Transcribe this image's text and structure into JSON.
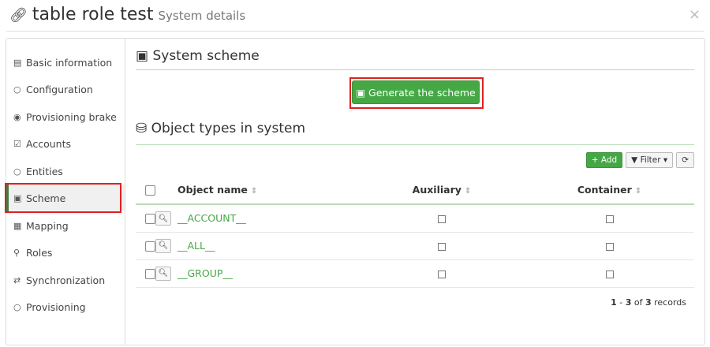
{
  "header": {
    "link_icon": "link-icon",
    "title": "table role test",
    "subtitle": "System details",
    "close_glyph": "×"
  },
  "sidebar": {
    "items": [
      {
        "label": "Basic information",
        "icon": "▤",
        "icon_name": "list-icon",
        "active": false
      },
      {
        "label": "Configuration",
        "icon": "○",
        "icon_name": "circle-icon",
        "active": false
      },
      {
        "label": "Provisioning brake",
        "icon": "◉",
        "icon_name": "dot-circle-icon",
        "active": false
      },
      {
        "label": "Accounts",
        "icon": "☑",
        "icon_name": "edit-icon",
        "active": false
      },
      {
        "label": "Entities",
        "icon": "○",
        "icon_name": "circle-icon",
        "active": false
      },
      {
        "label": "Scheme",
        "icon": "▣",
        "icon_name": "scheme-icon",
        "active": true
      },
      {
        "label": "Mapping",
        "icon": "▦",
        "icon_name": "mapping-icon",
        "active": false
      },
      {
        "label": "Roles",
        "icon": "⚲",
        "icon_name": "key-icon",
        "active": false
      },
      {
        "label": "Synchronization",
        "icon": "⇄",
        "icon_name": "exchange-icon",
        "active": false
      },
      {
        "label": "Provisioning",
        "icon": "○",
        "icon_name": "circle-icon",
        "active": false
      }
    ]
  },
  "scheme": {
    "icon": "▣",
    "title": "System scheme",
    "generate_label": "Generate the scheme"
  },
  "object_types": {
    "icon": "⛁",
    "title": "Object types in system",
    "add_label": "+ Add",
    "filter_label": "▼ Filter ▾",
    "refresh_glyph": "⟳",
    "columns": {
      "name": "Object name",
      "auxiliary": "Auxiliary",
      "container": "Container"
    },
    "sort_glyph": "⇕",
    "rows": [
      {
        "name": "__ACCOUNT__",
        "auxiliary": false,
        "container": false
      },
      {
        "name": "__ALL__",
        "auxiliary": false,
        "container": false
      },
      {
        "name": "__GROUP__",
        "auxiliary": false,
        "container": false
      }
    ],
    "records": {
      "from": "1",
      "sep": " - ",
      "to": "3",
      "of": " of ",
      "total": "3",
      "suffix": " records"
    }
  },
  "colors": {
    "accent_green": "#45a845",
    "highlight_red": "#e02020"
  }
}
